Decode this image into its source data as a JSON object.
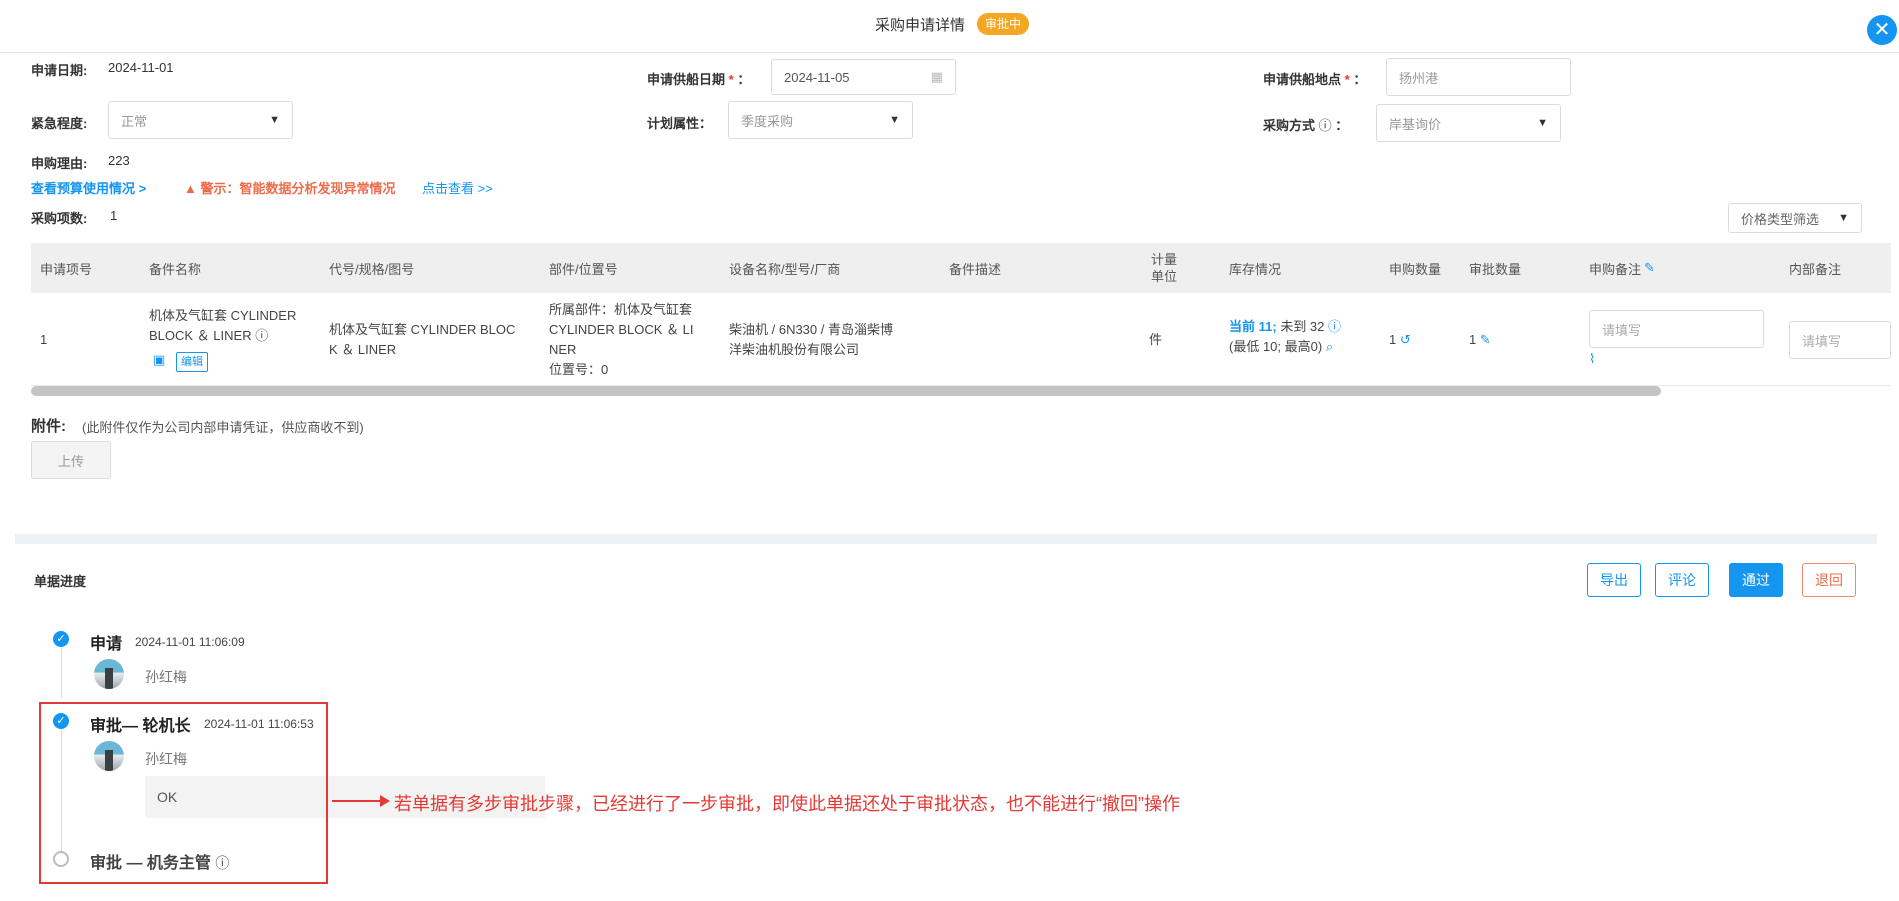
{
  "header": {
    "title": "采购申请详情",
    "status_badge": "审批中",
    "close_icon": "close-icon"
  },
  "form": {
    "apply_date_label": "申请日期:",
    "apply_date_value": "2024-11-01",
    "ship_date_label": "申请供船日期",
    "ship_date_value": "2024-11-05",
    "ship_place_label": "申请供船地点",
    "ship_place_placeholder": "扬州港",
    "urgency_label": "紧急程度:",
    "urgency_value": "正常",
    "plan_attr_label": "计划属性：",
    "plan_attr_value": "季度采购",
    "purchase_method_label": "采购方式",
    "purchase_method_value": "岸基询价",
    "reason_label": "申购理由:",
    "reason_value": "223",
    "budget_link": "查看预算使用情况 >",
    "warning_text": "警示：智能数据分析发现异常情况",
    "warning_link": "点击查看 >>",
    "item_count_label": "采购项数:",
    "item_count_value": "1",
    "price_filter": "价格类型筛选",
    "colon": "：",
    "required_star": "*"
  },
  "table": {
    "headers": [
      "申请项号",
      "备件名称",
      "代号/规格/图号",
      "部件/位置号",
      "设备名称/型号/厂商",
      "备件描述",
      "计量单位",
      "库存情况",
      "申购数量",
      "审批数量",
      "申购备注",
      "内部备注"
    ],
    "row": {
      "item_no": "1",
      "name": "机体及气缸套 CYLINDER BLOCK ＆ LINER",
      "edit_label": "编辑",
      "spec_line1": "机体及气缸套 CYLINDER BLOC",
      "spec_line2": "K ＆ LINER",
      "part_line1": "所属部件：机体及气缸套",
      "part_line2": "CYLINDER BLOCK ＆ LI",
      "part_line3": "NER",
      "part_line4": "位置号：0",
      "equip_line1": "柴油机 / 6N330 / 青岛淄柴博",
      "equip_line2": "洋柴油机股份有限公司",
      "unit": "件",
      "stock_current": "当前 11;",
      "stock_pending": "未到 32",
      "stock_minmax": "(最低 10; 最高0)",
      "apply_qty": "1",
      "approve_qty": "1",
      "remark_placeholder": "请填写",
      "internal_placeholder": "请填写"
    }
  },
  "attachment": {
    "label": "附件:",
    "note": "(此附件仅作为公司内部申请凭证，供应商收不到)",
    "upload_button": "上传"
  },
  "progress": {
    "title": "单据进度",
    "buttons": {
      "export": "导出",
      "comment": "评论",
      "pass": "通过",
      "return": "退回"
    },
    "steps": [
      {
        "title": "申请",
        "time": "2024-11-01 11:06:09",
        "person": "孙红梅"
      },
      {
        "title": "审批— 轮机长",
        "time": "2024-11-01 11:06:53",
        "person": "孙红梅",
        "comment": "OK"
      },
      {
        "title": "审批 — 机务主管"
      }
    ]
  },
  "annotation": "若单据有多步审批步骤，已经进行了一步审批，即使此单据还处于审批状态，也不能进行“撤回”操作",
  "colors": {
    "accent": "#1496f0",
    "badge": "#f5a623",
    "warning": "#ef6c4a",
    "annotation": "#e53935"
  }
}
